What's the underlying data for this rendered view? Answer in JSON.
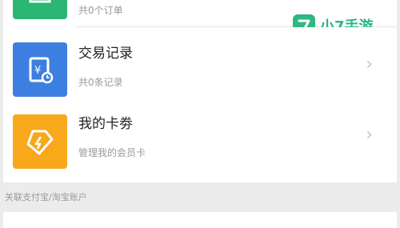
{
  "orders": {
    "subtitle": "共0个订单"
  },
  "transactions": {
    "title": "交易记录",
    "subtitle": "共0条记录"
  },
  "coupons": {
    "title": "我的卡劵",
    "subtitle": "管理我的会员卡"
  },
  "section": {
    "label": "关联支付宝/淘宝账户"
  },
  "chevron": "›",
  "watermark": {
    "text": "小7手游"
  },
  "colors": {
    "green": "#2bb673",
    "blue": "#3d7fe0",
    "orange": "#f7a81b",
    "brand": "#2db783"
  },
  "icons": [
    "orders-icon",
    "receipt-yen-icon",
    "ticket-bolt-icon",
    "chevron-right-icon"
  ]
}
